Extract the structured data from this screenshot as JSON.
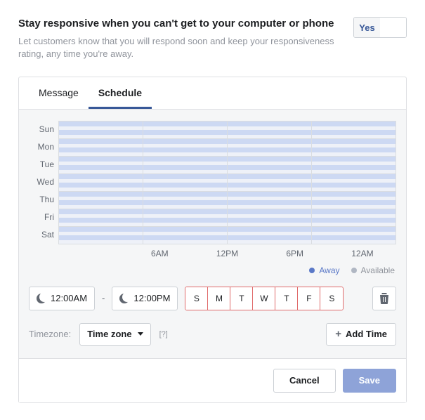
{
  "header": {
    "title": "Stay responsive when you can't get to your computer or phone",
    "subtitle": "Let customers know that you will respond soon and keep your responsiveness rating, any time you're away.",
    "toggle_yes": "Yes",
    "toggle_state": "yes"
  },
  "tabs": {
    "message": "Message",
    "schedule": "Schedule",
    "active": "schedule"
  },
  "chart_data": {
    "type": "heatmap",
    "rows": [
      "Sun",
      "Mon",
      "Tue",
      "Wed",
      "Thu",
      "Fri",
      "Sat"
    ],
    "x_ticks": [
      "",
      "6AM",
      "12PM",
      "6PM",
      "12AM"
    ],
    "state_all": "away"
  },
  "legend": {
    "away": "Away",
    "available": "Available"
  },
  "time_range": {
    "start": "12:00AM",
    "end": "12:00PM",
    "separator": "-",
    "days": [
      "S",
      "M",
      "T",
      "W",
      "T",
      "F",
      "S"
    ]
  },
  "timezone": {
    "label": "Timezone:",
    "value": "Time zone",
    "help": "[?]"
  },
  "add_time_label": "Add Time",
  "footer": {
    "cancel": "Cancel",
    "save": "Save"
  }
}
